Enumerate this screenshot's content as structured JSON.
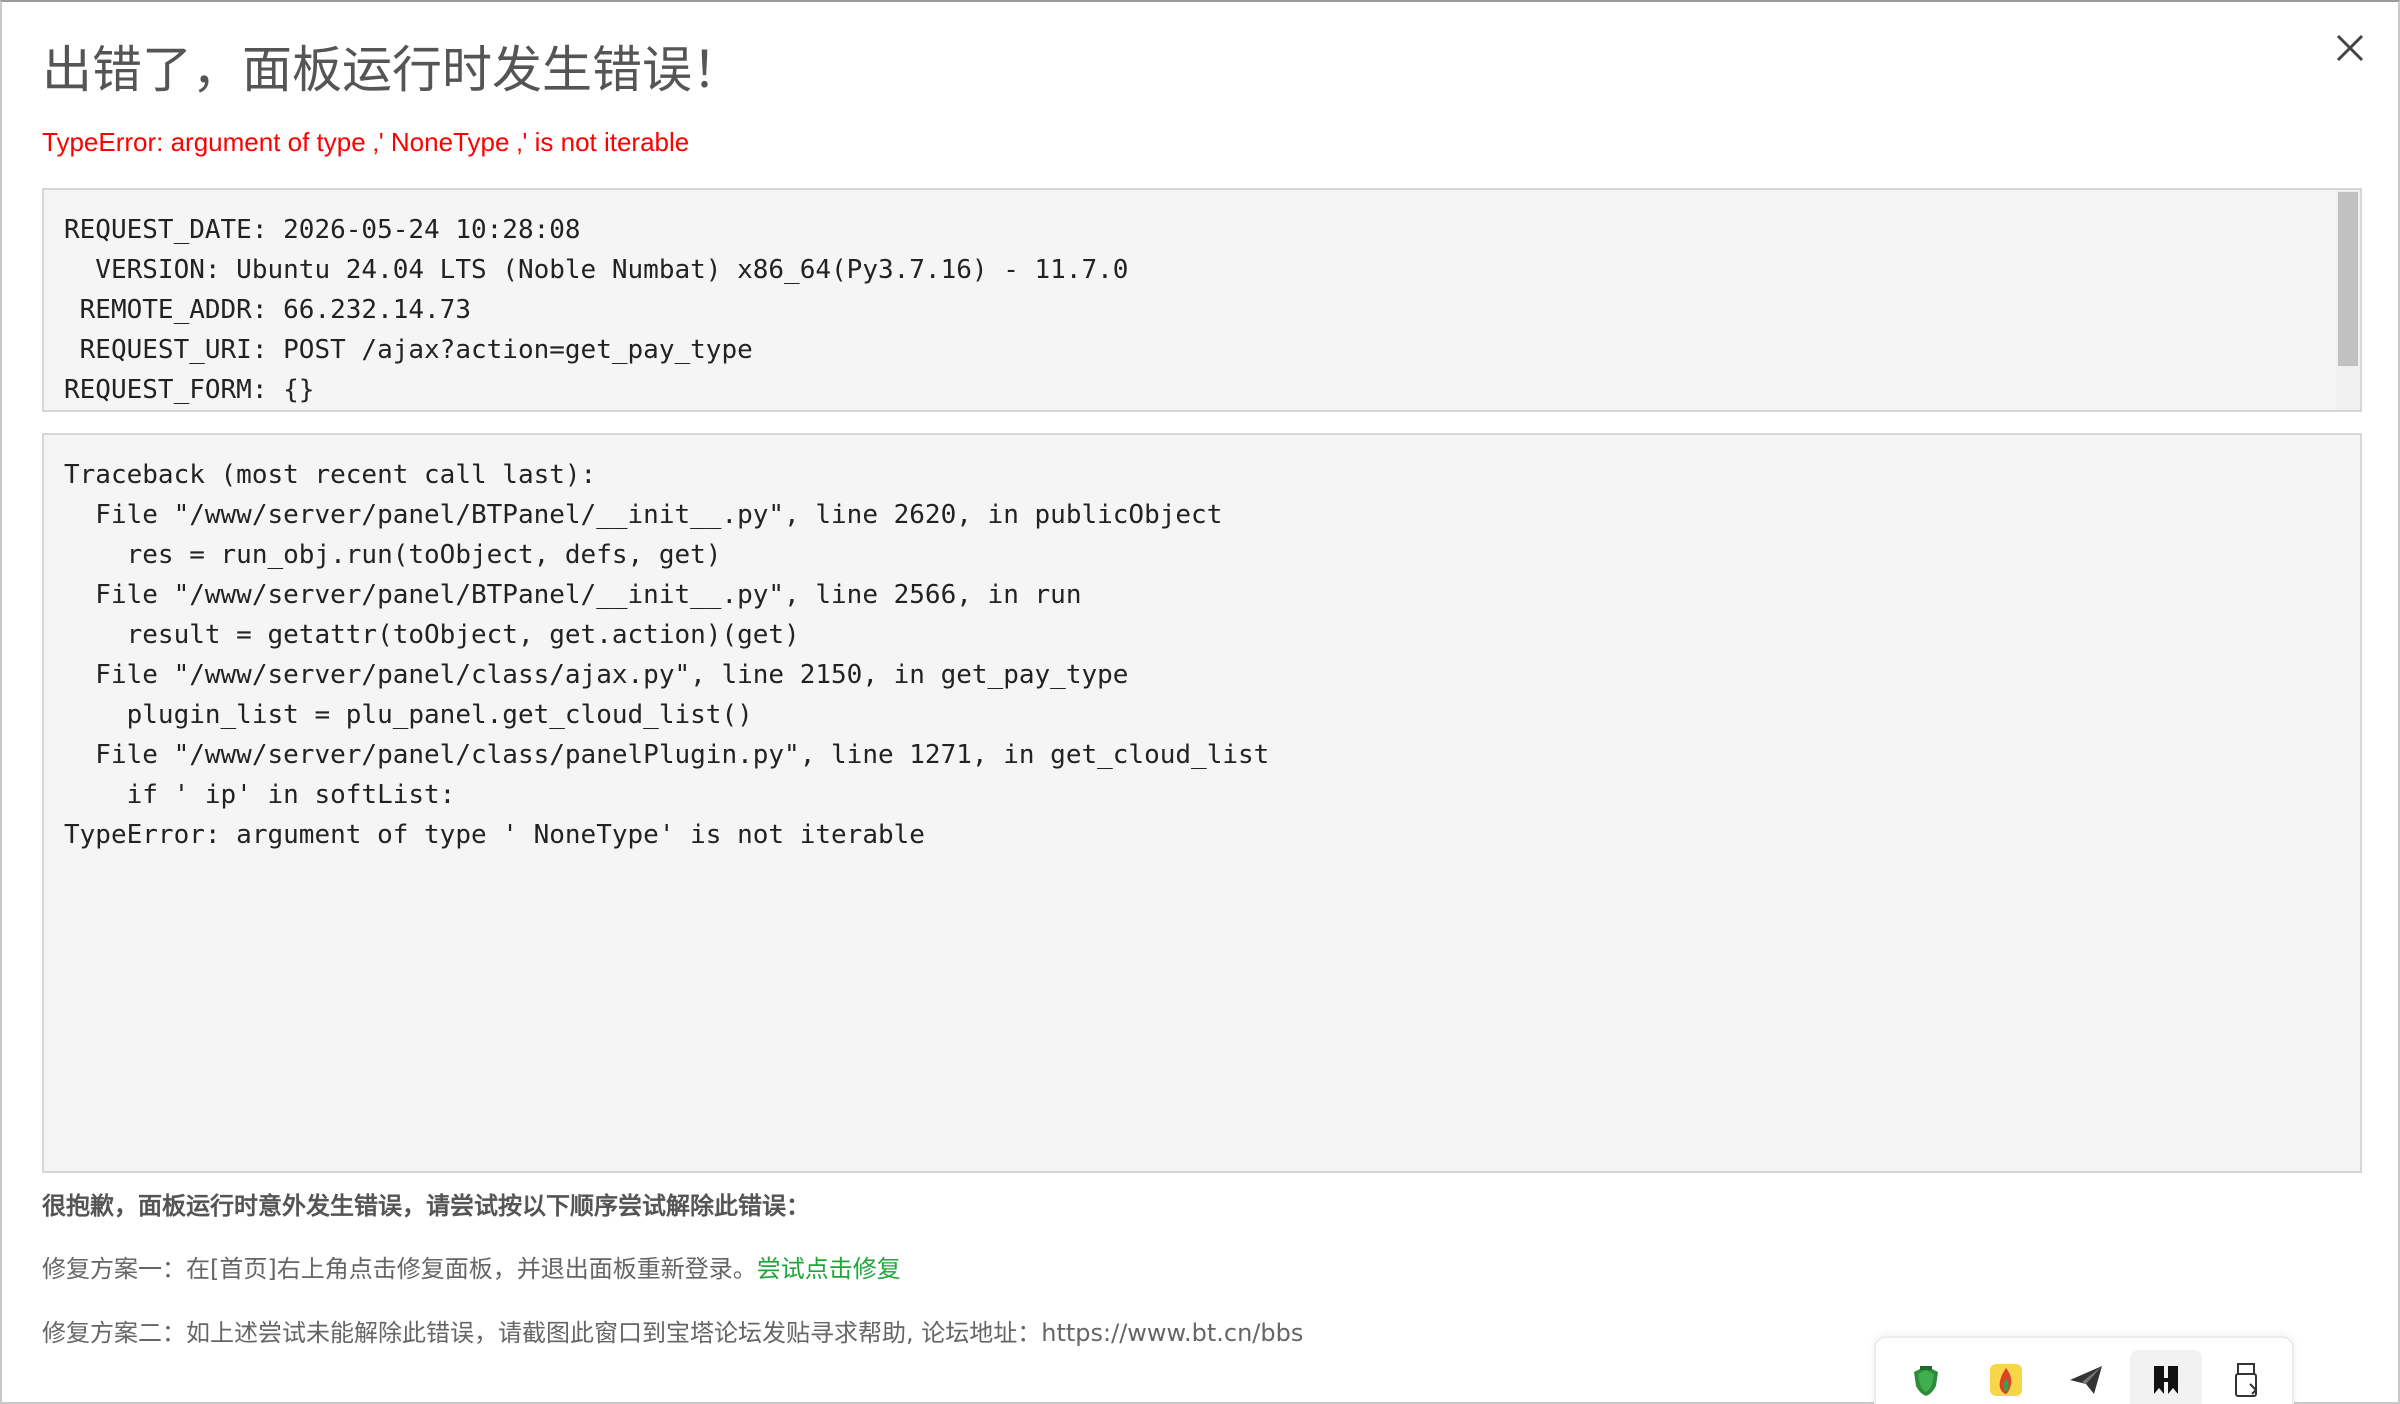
{
  "dialog": {
    "title": "出错了，面板运行时发生错误！",
    "error_message": "TypeError: argument of type ‚' NoneType ‚' is not iterable"
  },
  "request_info": {
    "lines": [
      "REQUEST_DATE: 2026-05-24 10:28:08",
      "  VERSION: Ubuntu 24.04 LTS (Noble Numbat) x86_64(Py3.7.16) - 11.7.0",
      " REMOTE_ADDR: 66.232.14.73",
      " REQUEST_URI: POST /ajax?action=get_pay_type",
      "REQUEST_FORM: {}"
    ]
  },
  "traceback": {
    "lines": [
      "Traceback (most recent call last):",
      "  File \"/www/server/panel/BTPanel/__init__.py\", line 2620, in publicObject",
      "    res = run_obj.run(toObject, defs, get)",
      "  File \"/www/server/panel/BTPanel/__init__.py\", line 2566, in run",
      "    result = getattr(toObject, get.action)(get)",
      "  File \"/www/server/panel/class/ajax.py\", line 2150, in get_pay_type",
      "    plugin_list = plu_panel.get_cloud_list()",
      "  File \"/www/server/panel/class/panelPlugin.py\", line 1271, in get_cloud_list",
      "    if ' ip' in softList:",
      "TypeError: argument of type ' NoneType' is not iterable"
    ]
  },
  "help": {
    "heading": "很抱歉，面板运行时意外发生错误，请尝试按以下顺序尝试解除此错误：",
    "fix_one_text": "修复方案一：在[首页]右上角点击修复面板，并退出面板重新登录。",
    "fix_one_link": "尝试点击修复",
    "fix_two_text": "修复方案二：如上述尝试未能解除此错误，请截图此窗口到宝塔论坛发贴寻求帮助, 论坛地址：https://www.bt.cn/bbs"
  },
  "tray": {
    "icons": [
      "shield-app-icon",
      "flame-app-icon",
      "send-app-icon",
      "bookmark-app-icon",
      "usb-drive-icon"
    ]
  },
  "colors": {
    "error": "#ff0000",
    "link": "#20a53a",
    "title": "#555555",
    "code_bg": "#f5f5f5"
  }
}
